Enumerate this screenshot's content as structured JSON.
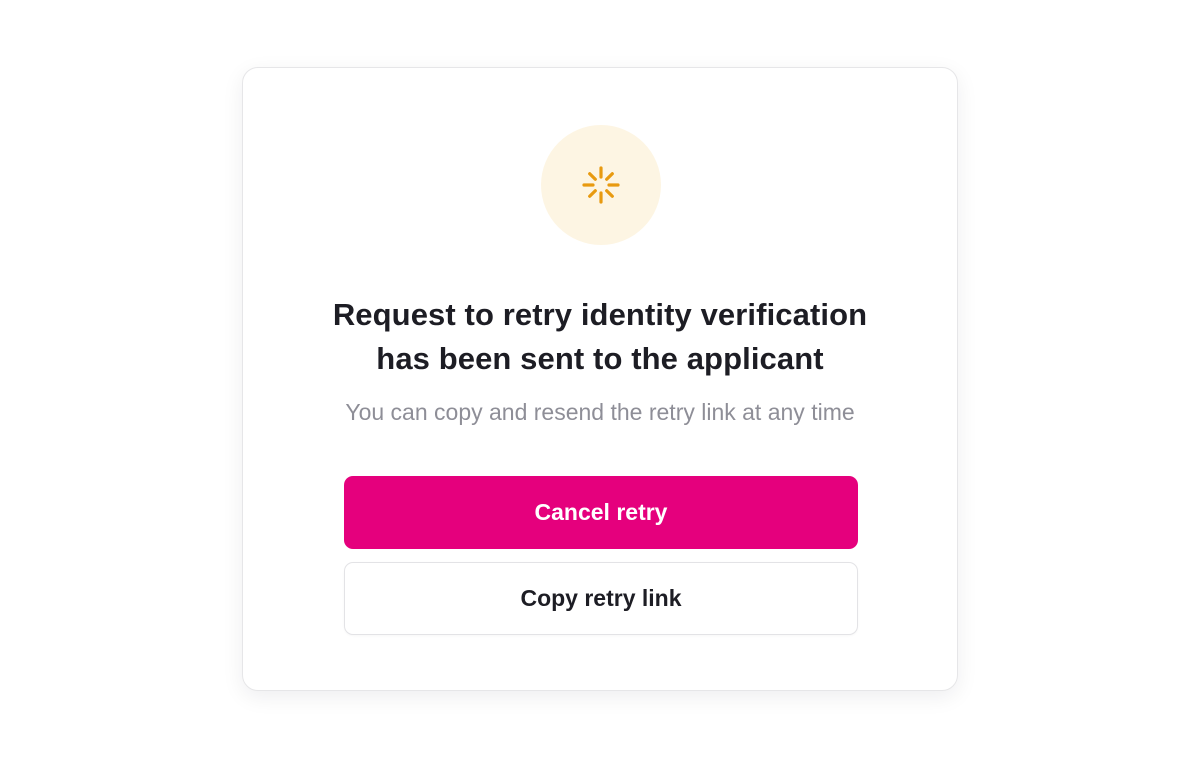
{
  "dialog": {
    "status_icon": "loading-spinner-icon",
    "title_line1": "Request to retry identity verification",
    "title_line2": "has been sent to the applicant",
    "subtitle": "You can copy and resend the retry link at any time"
  },
  "actions": {
    "primary_label": "Cancel retry",
    "secondary_label": "Copy retry link"
  },
  "colors": {
    "accent": "#e5007d",
    "icon": "#e89a10",
    "icon_background": "#fdf5e3",
    "title": "#1d1d24",
    "subtitle": "#8e8e97"
  }
}
